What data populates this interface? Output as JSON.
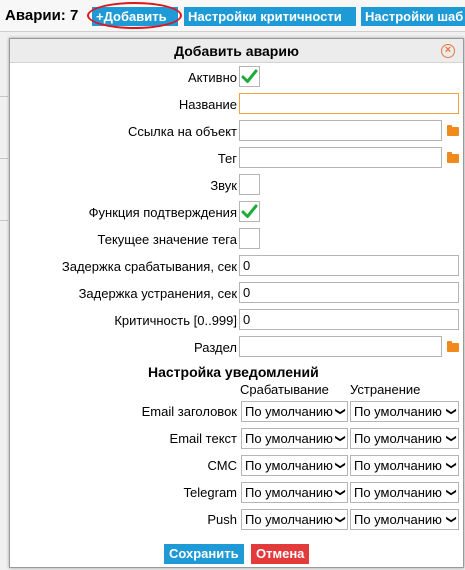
{
  "header": {
    "title": "Аварии: 7",
    "add_button": "+Добавить",
    "criticality_button": "Настройки критичности",
    "templates_button": "Настройки шаб"
  },
  "dialog": {
    "title": "Добавить аварию",
    "close_icon": "close-icon",
    "active_label": "Активно",
    "active_checked": true,
    "name_label": "Название",
    "name_value": "",
    "object_link_label": "Ссылка на объект",
    "object_link_value": "",
    "tag_label": "Тег",
    "tag_value": "",
    "sound_label": "Звук",
    "sound_checked": false,
    "confirm_label": "Функция подтверждения",
    "confirm_checked": true,
    "current_tag_label": "Текущее значение тега",
    "current_tag_checked": false,
    "trigger_delay_label": "Задержка срабатывания, сек",
    "trigger_delay_value": "0",
    "clear_delay_label": "Задержка устранения, сек",
    "clear_delay_value": "0",
    "criticality_label": "Критичность [0..999]",
    "criticality_value": "0",
    "section_label": "Раздел",
    "section_value": ""
  },
  "notifications": {
    "title": "Настройка уведомлений",
    "col_trigger": "Срабатывание",
    "col_clear": "Устранение",
    "rows": [
      {
        "label": "Email заголовок",
        "trigger": "По умолчанию",
        "clear": "По умолчанию"
      },
      {
        "label": "Email текст",
        "trigger": "По умолчанию",
        "clear": "По умолчанию"
      },
      {
        "label": "СМС",
        "trigger": "По умолчанию",
        "clear": "По умолчанию"
      },
      {
        "label": "Telegram",
        "trigger": "По умолчанию",
        "clear": "По умолчанию"
      },
      {
        "label": "Push",
        "trigger": "По умолчанию",
        "clear": "По умолчанию"
      }
    ]
  },
  "actions": {
    "save": "Сохранить",
    "cancel": "Отмена"
  },
  "colors": {
    "accent": "#1e9ad6",
    "danger": "#e33b3b",
    "check": "#1faa3a",
    "folder": "#f08a1c"
  }
}
